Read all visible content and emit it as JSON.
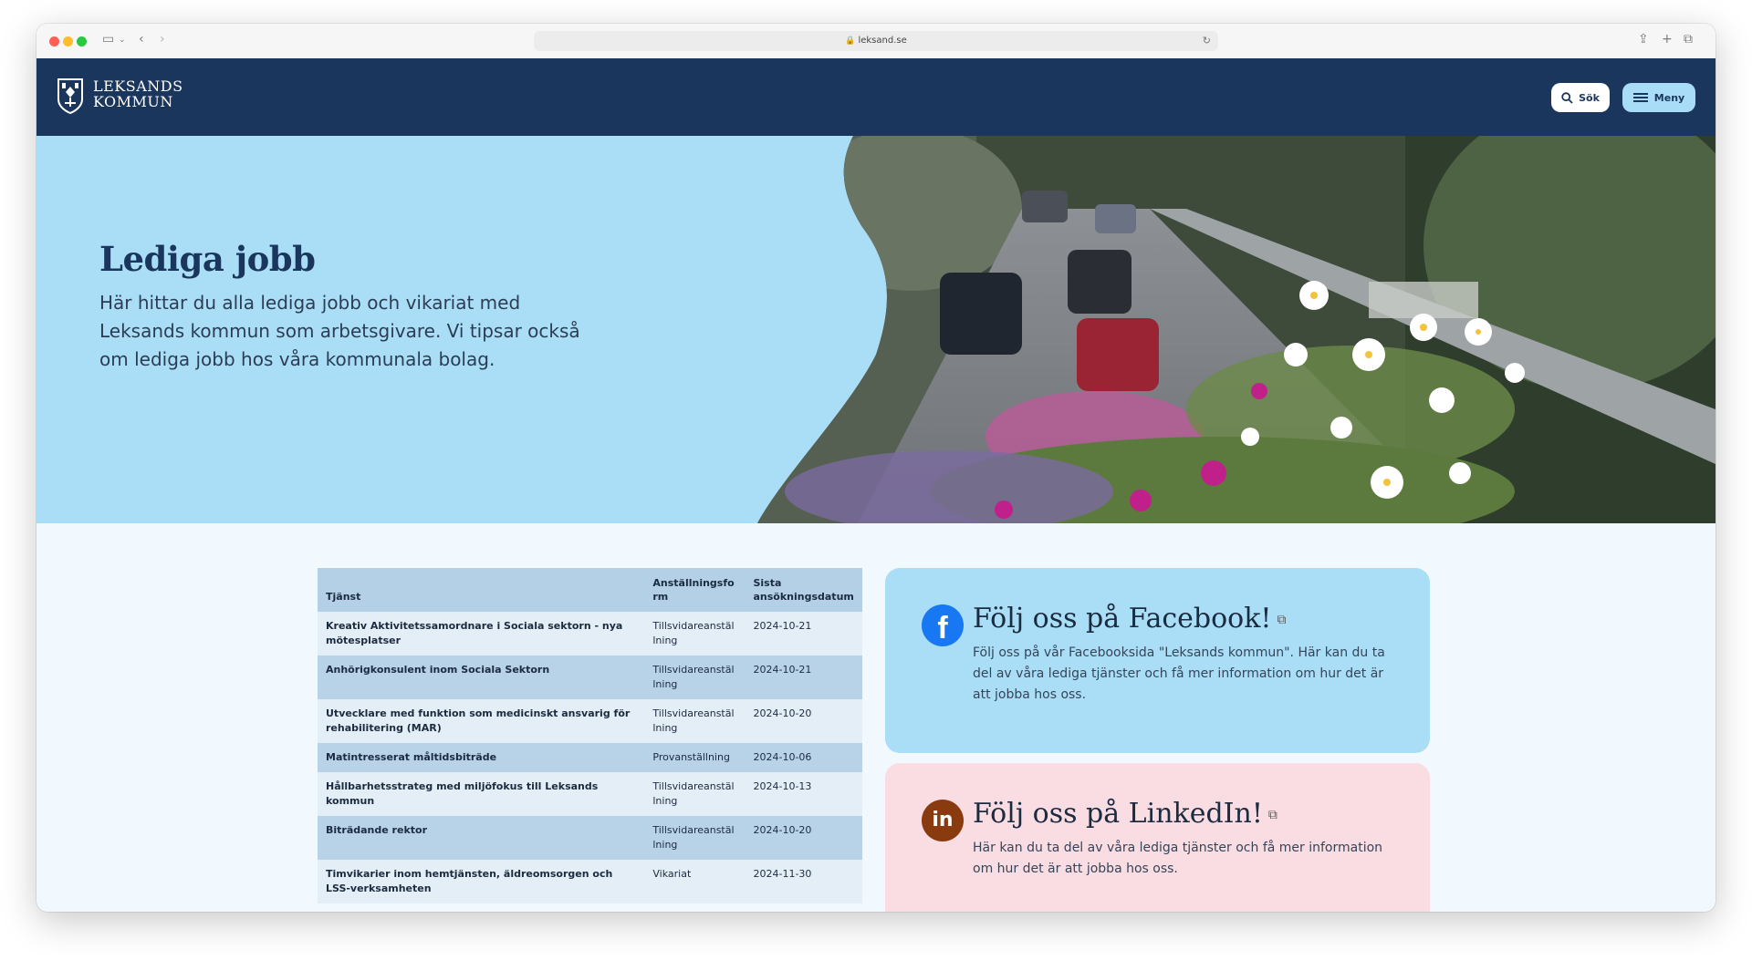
{
  "browser": {
    "url": "leksand.se"
  },
  "header": {
    "logo_line1": "LEKSANDS",
    "logo_line2": "KOMMUN",
    "search_label": "Sök",
    "menu_label": "Meny"
  },
  "hero": {
    "title": "Lediga jobb",
    "description": "Här hittar du alla lediga jobb och vikariat med Leksands kommun som arbetsgivare. Vi tipsar också om lediga jobb hos våra kommunala bolag."
  },
  "jobs": {
    "columns": [
      "Tjänst",
      "Anställningsform",
      "Sista ansökningsdatum"
    ],
    "rows": [
      {
        "title": "Kreativ Aktivitetssamordnare i Sociala sektorn - nya mötesplatser",
        "form": "Tillsvidareanställning",
        "deadline": "2024-10-21"
      },
      {
        "title": "Anhörigkonsulent inom Sociala Sektorn",
        "form": "Tillsvidareanställning",
        "deadline": "2024-10-21"
      },
      {
        "title": "Utvecklare med funktion som medicinskt ansvarig för rehabilitering (MAR)",
        "form": "Tillsvidareanställning",
        "deadline": "2024-10-20"
      },
      {
        "title": "Matintresserat måltidsbiträde",
        "form": "Provanställning",
        "deadline": "2024-10-06"
      },
      {
        "title": "Hållbarhetsstrateg med miljöfokus till Leksands kommun",
        "form": "Tillsvidareanställning",
        "deadline": "2024-10-13"
      },
      {
        "title": "Biträdande rektor",
        "form": "Tillsvidareanställning",
        "deadline": "2024-10-20"
      },
      {
        "title": "Timvikarier inom hemtjänsten, äldreomsorgen och LSS-verksamheten",
        "form": "Vikariat",
        "deadline": "2024-11-30"
      }
    ]
  },
  "facebook": {
    "title": "Följ oss på Facebook!",
    "text": "Följ oss på vår Facebooksida \"Leksands kommun\". Här kan du ta del av våra lediga tjänster och få mer information om hur det är att jobba hos oss."
  },
  "linkedin": {
    "title": "Följ oss på LinkedIn!",
    "text": "Här kan du ta del av våra lediga tjänster och få mer information om hur det är att jobba hos oss."
  },
  "colors": {
    "header_bg": "#1b365d",
    "hero_bg": "#aadef7",
    "facebook_card": "#aadef7",
    "linkedin_card": "#fadde2",
    "facebook_blue": "#1877f2",
    "linkedin_brown": "#8a3a0f"
  },
  "icons": {
    "facebook_glyph": "f",
    "linkedin_glyph": "in",
    "external": "⧉"
  }
}
